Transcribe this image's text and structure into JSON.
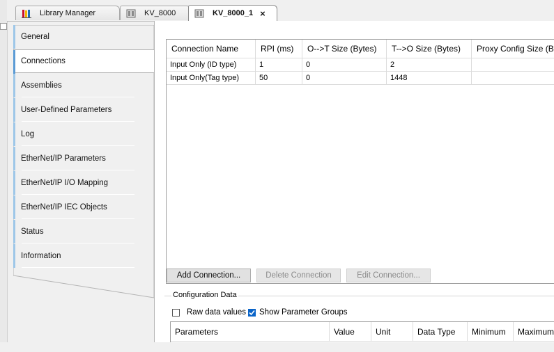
{
  "tabs": [
    {
      "label": "Library Manager",
      "icon": "library-books-icon"
    },
    {
      "label": "KV_8000",
      "icon": "device-module-icon"
    },
    {
      "label": "KV_8000_1",
      "icon": "device-module-icon",
      "active": true,
      "close": "×"
    }
  ],
  "nav": {
    "items": [
      {
        "label": "General"
      },
      {
        "label": "Connections",
        "selected": true
      },
      {
        "label": "Assemblies"
      },
      {
        "label": "User-Defined Parameters"
      },
      {
        "label": "Log"
      },
      {
        "label": "EtherNet/IP Parameters"
      },
      {
        "label": "EtherNet/IP I/O Mapping"
      },
      {
        "label": "EtherNet/IP IEC Objects"
      },
      {
        "label": "Status"
      },
      {
        "label": "Information"
      }
    ]
  },
  "connections": {
    "columns": [
      "Connection Name",
      "RPI (ms)",
      "O-->T Size (Bytes)",
      "T-->O Size (Bytes)",
      "Proxy Config Size (By"
    ],
    "rows": [
      [
        "Input Only (ID type)",
        "1",
        "0",
        "2",
        ""
      ],
      [
        "Input Only(Tag type)",
        "50",
        "0",
        "1448",
        ""
      ]
    ],
    "buttons": {
      "add": "Add Connection...",
      "delete": "Delete Connection",
      "edit": "Edit Connection..."
    }
  },
  "config": {
    "title": "Configuration Data",
    "raw_data_label": "Raw data values",
    "raw_data_checked": false,
    "show_groups_label": "Show Parameter Groups",
    "show_groups_checked": true,
    "columns": [
      "Parameters",
      "Value",
      "Unit",
      "Data Type",
      "Minimum",
      "Maximum"
    ]
  },
  "colors": {
    "accent": "#5b9bd5",
    "checkbox": "#0a64c8"
  }
}
